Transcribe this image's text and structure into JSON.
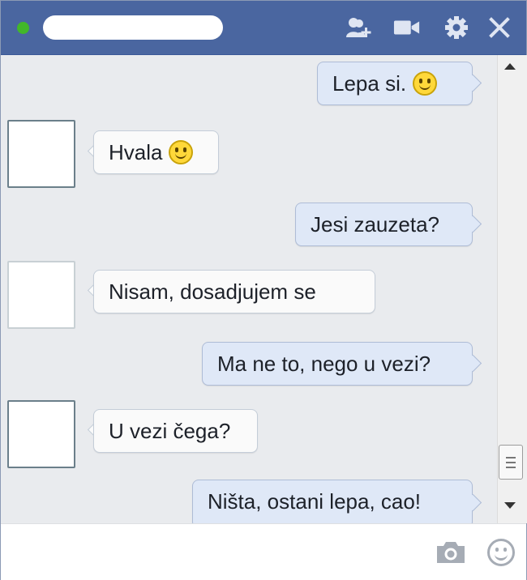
{
  "titlebar": {
    "contact_name": "",
    "status": "online",
    "icons": [
      "add-friend-icon",
      "video-call-icon",
      "gear-icon",
      "close-icon"
    ]
  },
  "messages": [
    {
      "direction": "outgoing",
      "text": "Lepa si.",
      "emoji": "smiley"
    },
    {
      "direction": "incoming",
      "text": "Hvala",
      "emoji": "smiley"
    },
    {
      "direction": "outgoing",
      "text": "Jesi zauzeta?"
    },
    {
      "direction": "incoming",
      "text": "Nisam, dosadjujem se"
    },
    {
      "direction": "outgoing",
      "text": "Ma ne to, nego u vezi?"
    },
    {
      "direction": "incoming",
      "text": "U vezi čega?"
    },
    {
      "direction": "outgoing",
      "text": "Ništa, ostani lepa, cao!"
    }
  ],
  "composer": {
    "value": "",
    "icons": [
      "camera-icon",
      "emoji-icon"
    ]
  },
  "colors": {
    "header": "#4a66a0",
    "online": "#42b72a",
    "outgoing_bubble": "#dfe8f7",
    "incoming_bubble": "#fafafa"
  }
}
